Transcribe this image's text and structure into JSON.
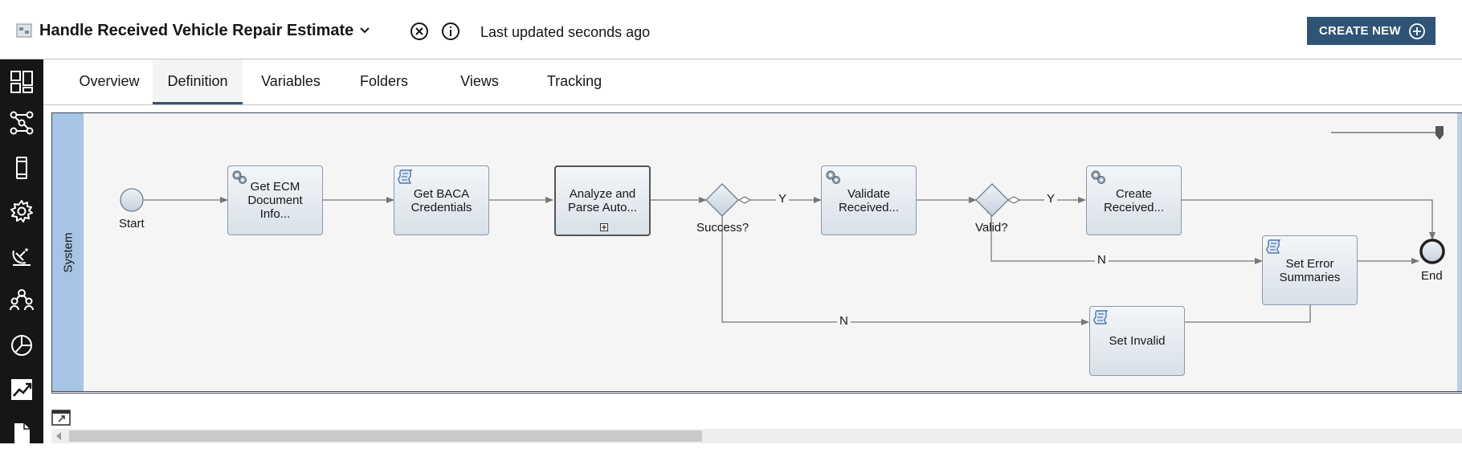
{
  "header": {
    "title": "Handle Received Vehicle Repair Estimate",
    "updated": "Last updated seconds ago",
    "create_label": "CREATE NEW"
  },
  "rail": {
    "items": [
      "dashboard-icon",
      "process-icon",
      "mobile-icon",
      "settings-icon",
      "satellite-icon",
      "users-icon",
      "pie-chart-icon",
      "trend-chart-icon",
      "document-icon"
    ]
  },
  "tabs": [
    "Overview",
    "Definition",
    "Variables",
    "Folders",
    "Views",
    "Tracking"
  ],
  "active_tab": "Definition",
  "diagram": {
    "lane": "System",
    "start_label": "Start",
    "end_label": "End",
    "nodes": {
      "get_ecm": "Get ECM Document Info...",
      "get_baca": "Get BACA Credentials",
      "analyze": "Analyze and Parse Auto...",
      "validate": "Validate Received...",
      "create": "Create Received...",
      "set_error": "Set Error Summaries",
      "set_invalid": "Set Invalid"
    },
    "gateways": {
      "success": "Success?",
      "valid": "Valid?"
    },
    "flow_labels": {
      "success_yes": "Y",
      "success_no": "N",
      "valid_yes": "Y",
      "valid_no": "N"
    }
  },
  "colors": {
    "accent": "#2f5475",
    "rail": "#161616",
    "lane": "#a6c4e4"
  }
}
